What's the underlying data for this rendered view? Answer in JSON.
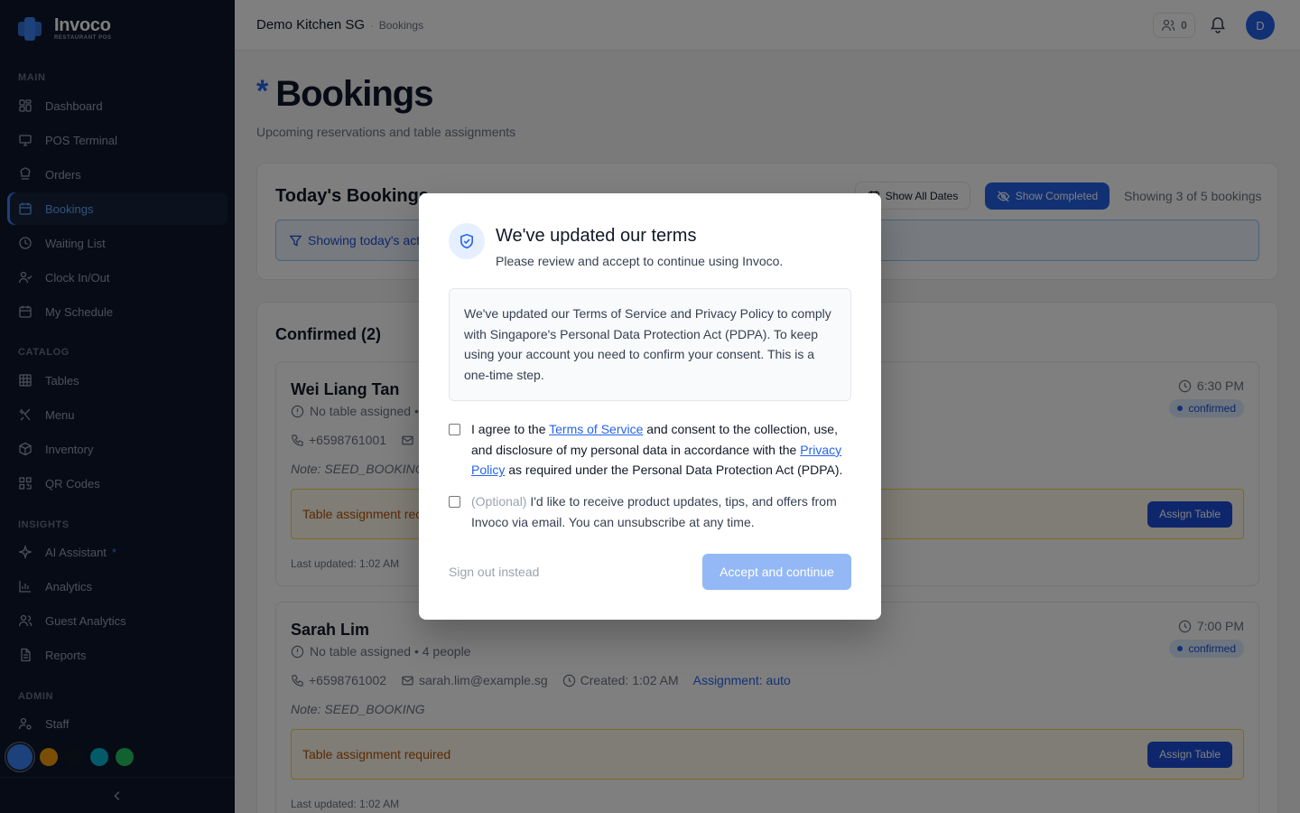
{
  "app": {
    "name": "Invoco",
    "tagline": "RESTAURANT POS"
  },
  "sidebar": {
    "sections": [
      {
        "label": "MAIN"
      },
      {
        "label": "CATALOG"
      },
      {
        "label": "INSIGHTS"
      },
      {
        "label": "ADMIN"
      }
    ],
    "items": [
      {
        "label": "Dashboard",
        "icon": "dashboard-icon"
      },
      {
        "label": "POS Terminal",
        "icon": "monitor-icon"
      },
      {
        "label": "Orders",
        "icon": "chef-hat-icon"
      },
      {
        "label": "Bookings",
        "icon": "calendar-icon",
        "active": true
      },
      {
        "label": "Waiting List",
        "icon": "clock-icon"
      },
      {
        "label": "Clock In/Out",
        "icon": "user-check-icon"
      },
      {
        "label": "My Schedule",
        "icon": "calendar-icon"
      },
      {
        "label": "Tables",
        "icon": "grid-icon"
      },
      {
        "label": "Menu",
        "icon": "utensils-icon"
      },
      {
        "label": "Inventory",
        "icon": "box-icon"
      },
      {
        "label": "QR Codes",
        "icon": "qr-code-icon"
      },
      {
        "label": "AI Assistant",
        "icon": "sparkles-icon",
        "marker": "*"
      },
      {
        "label": "Analytics",
        "icon": "bar-chart-icon"
      },
      {
        "label": "Guest Analytics",
        "icon": "users-icon"
      },
      {
        "label": "Reports",
        "icon": "file-text-icon"
      },
      {
        "label": "Staff",
        "icon": "user-cog-icon"
      }
    ],
    "theme_swatches": [
      "#3b82f6",
      "#f59e0b",
      "#111827",
      "#06b6d4",
      "#22c55e"
    ]
  },
  "topbar": {
    "restaurant": "Demo Kitchen SG",
    "separator": "·",
    "page": "Bookings",
    "online_count": "0",
    "avatar_initial": "D"
  },
  "page": {
    "title_marker": "*",
    "title": "Bookings",
    "subtitle": "Upcoming reservations and table assignments"
  },
  "today": {
    "heading": "Today's Bookings",
    "show_all_dates": "Show All Dates",
    "show_completed": "Show Completed",
    "showing": "Showing 3 of 5 bookings",
    "filter_text": "Showing today's acti"
  },
  "confirmed": {
    "heading": "Confirmed (2)",
    "bookings": [
      {
        "name": "Wei Liang Tan",
        "table": "No table assigned • ",
        "time": "6:30 PM",
        "status": "confirmed",
        "phone": "+6598761001",
        "email": "",
        "created": "",
        "assignment": "",
        "note": "Note: SEED_BOOKINC",
        "warning": "Table assignment rec",
        "assign_button": "Assign Table",
        "updated": "Last updated: 1:02 AM"
      },
      {
        "name": "Sarah Lim",
        "table": "No table assigned • 4 people",
        "time": "7:00 PM",
        "status": "confirmed",
        "phone": "+6598761002",
        "email": "sarah.lim@example.sg",
        "created": "Created: 1:02 AM",
        "assignment": "Assignment: auto",
        "note": "Note: SEED_BOOKING",
        "warning": "Table assignment required",
        "assign_button": "Assign Table",
        "updated": "Last updated: 1:02 AM"
      }
    ]
  },
  "modal": {
    "title": "We've updated our terms",
    "subtitle": "Please review and accept to continue using Invoco.",
    "notice": "We've updated our Terms of Service and Privacy Policy to comply with Singapore's Personal Data Protection Act (PDPA). To keep using your account you need to confirm your consent. This is a one-time step.",
    "agree_prefix": "I agree to the ",
    "terms_link": "Terms of Service",
    "agree_middle": " and consent to the collection, use, and disclosure of my personal data in accordance with the ",
    "privacy_link": "Privacy Policy",
    "agree_suffix": " as required under the Personal Data Protection Act (PDPA).",
    "optional_tag": "(Optional)",
    "optional_text": " I'd like to receive product updates, tips, and offers from Invoco via email. You can unsubscribe at any time.",
    "sign_out": "Sign out instead",
    "accept": "Accept and continue"
  }
}
